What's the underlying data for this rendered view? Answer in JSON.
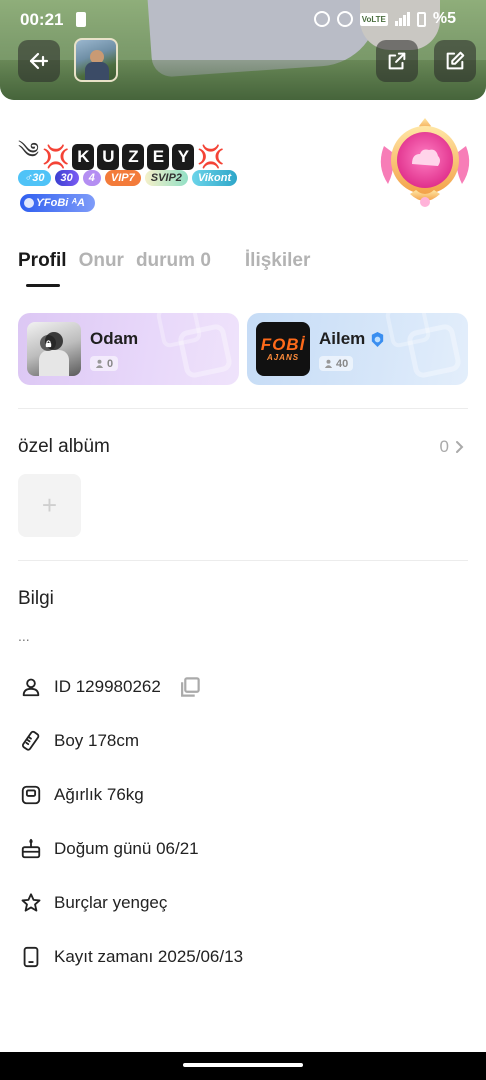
{
  "status_bar": {
    "time": "00:21",
    "battery": "%5",
    "network": "4G",
    "volte": "VoLTE"
  },
  "header": {
    "back_icon": "back-arrow-icon",
    "share_icon": "share-icon",
    "edit_icon": "edit-icon"
  },
  "profile": {
    "name_letters": [
      "K",
      "U",
      "Z",
      "E",
      "Y"
    ],
    "name_prefix": "༄",
    "name_decoration": "💢",
    "badges": [
      {
        "label": "♂30",
        "style": "male"
      },
      {
        "label": "30",
        "style": "gem"
      },
      {
        "label": "4",
        "style": "star"
      },
      {
        "label": "VIP7",
        "style": "vip"
      },
      {
        "label": "SVIP2",
        "style": "svip"
      },
      {
        "label": "Vikont",
        "style": "vikont"
      }
    ],
    "fobi_badge": "ƳFoBi ᴬA"
  },
  "tabs": [
    {
      "label": "Profil",
      "active": true
    },
    {
      "label": "Onur",
      "active": false
    },
    {
      "label": "durum 0",
      "active": false
    },
    {
      "label": "İlişkiler",
      "active": false
    }
  ],
  "rooms": {
    "odam": {
      "title": "Odam",
      "count": "0"
    },
    "ailem": {
      "title": "Ailem",
      "count": "40",
      "logo_main": "FOBİ",
      "logo_sub": "AJANS"
    }
  },
  "album": {
    "title": "özel albüm",
    "count": "0",
    "add_label": "+"
  },
  "info": {
    "title": "Bilgi",
    "bio": "...",
    "rows": [
      {
        "icon": "person-icon",
        "text": "ID 129980262"
      },
      {
        "icon": "height-icon",
        "text": "Boy 178cm"
      },
      {
        "icon": "weight-icon",
        "text": "Ağırlık 76kg"
      },
      {
        "icon": "cake-icon",
        "text": "Doğum günü 06/21"
      },
      {
        "icon": "star-icon",
        "text": "Burçlar yengeç"
      },
      {
        "icon": "phone-icon",
        "text": "Kayıt zamanı 2025/06/13"
      }
    ]
  },
  "colors": {
    "accent_dark": "#1a1a1a",
    "tab_inactive": "#b3b3b3",
    "odam_card": "#dcc7f4",
    "ailem_card": "#c6dcf6"
  }
}
